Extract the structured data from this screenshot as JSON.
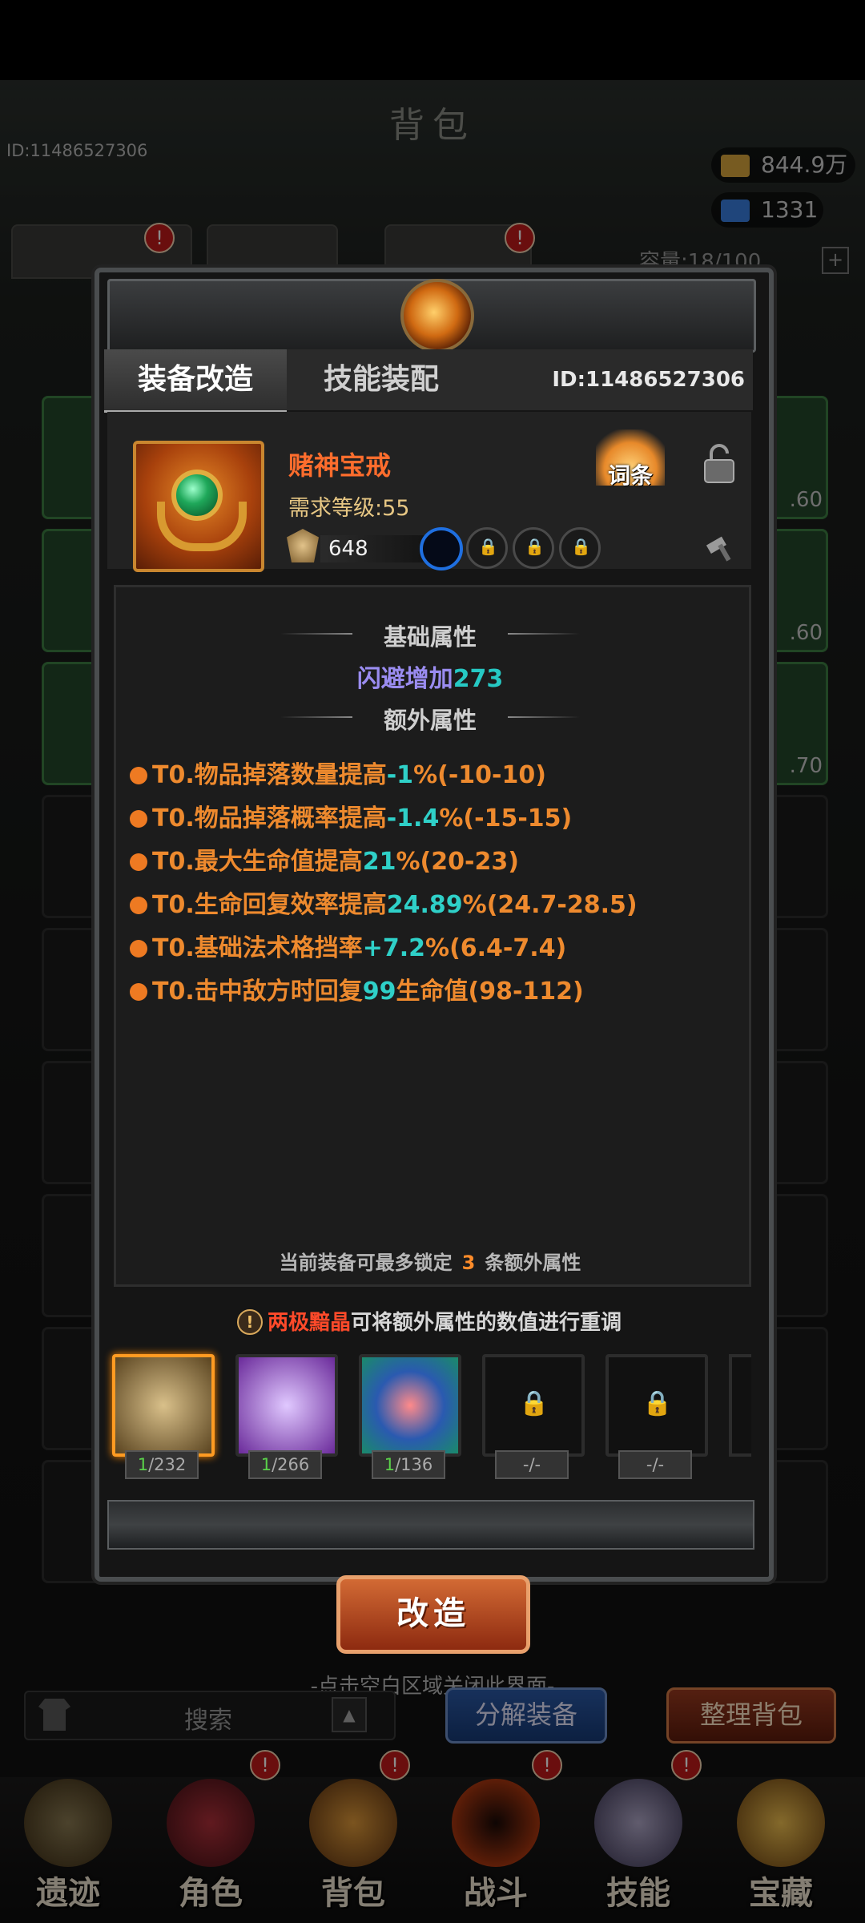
{
  "background": {
    "title": "背包",
    "player_id": "ID:11486527306",
    "gold": "844.9万",
    "gems": "1331",
    "capacity": "容量:18/100",
    "slot_levels": [
      ".60",
      ".60",
      ".70"
    ],
    "close_hint": "-点击空白区域关闭此界面-",
    "search_label": "搜索",
    "decompose_label": "分解装备",
    "sort_label": "整理背包",
    "nav": [
      "遗迹",
      "角色",
      "背包",
      "战斗",
      "技能",
      "宝藏"
    ],
    "badge": "!"
  },
  "modal": {
    "tabs": {
      "modify": "装备改造",
      "skill": "技能装配"
    },
    "id": "ID:11486527306",
    "item": {
      "name": "赌神宝戒",
      "requirement": "需求等级:55",
      "power": "648",
      "affix_label": "词条"
    },
    "base_title": "基础属性",
    "base_attr": {
      "text": "闪避增加",
      "value": "273"
    },
    "extra_title": "额外属性",
    "extra_attrs": [
      {
        "pre": "T0.物品掉落数量提高",
        "val": "-1",
        "post": "%(-10-10)"
      },
      {
        "pre": "T0.物品掉落概率提高",
        "val": "-1.4",
        "post": "%(-15-15)"
      },
      {
        "pre": "T0.最大生命值提高",
        "val": "21",
        "post": "%(20-23)"
      },
      {
        "pre": "T0.生命回复效率提高",
        "val": "24.89",
        "post": "%(24.7-28.5)"
      },
      {
        "pre": "T0.基础法术格挡率",
        "val": "+7.2",
        "post": "%(6.4-7.4)"
      },
      {
        "pre": "T0.击中敌方时回复",
        "val": "99",
        "post": "生命值(98-112)"
      }
    ],
    "lock_hint": {
      "pre": "当前装备可最多锁定",
      "num": "3",
      "post": "条额外属性"
    },
    "material_hint": {
      "excl": "!",
      "highlight": "两极黯晶",
      "rest": "可将额外属性的数值进行重调"
    },
    "materials": [
      {
        "have": "1",
        "total": "/232"
      },
      {
        "have": "1",
        "total": "/266"
      },
      {
        "have": "1",
        "total": "/136"
      },
      {
        "have": "",
        "total": "-/-"
      },
      {
        "have": "",
        "total": "-/-"
      }
    ],
    "modify_button": "改造"
  },
  "colors": {
    "accent": "#ff6d2d",
    "value": "#2fd0c8",
    "attr": "#ee8a2e"
  }
}
